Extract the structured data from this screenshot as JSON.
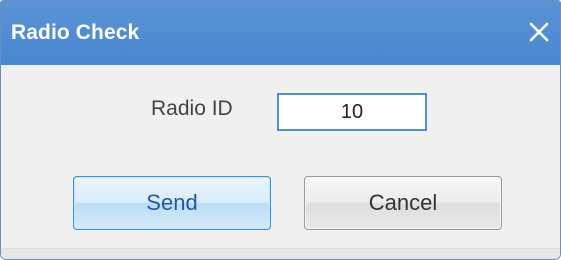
{
  "dialog": {
    "title": "Radio Check",
    "close_icon": "close-x-icon"
  },
  "form": {
    "radio_id_label": "Radio ID",
    "radio_id_value": "10"
  },
  "buttons": {
    "send_label": "Send",
    "cancel_label": "Cancel"
  },
  "colors": {
    "titlebar": "#4a86cf",
    "accent": "#3d8fe0",
    "background": "#f0f0f0"
  }
}
